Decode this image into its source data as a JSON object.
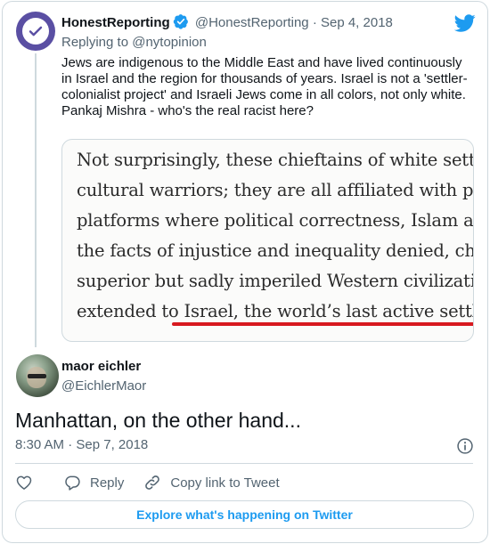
{
  "first_tweet": {
    "display_name": "HonestReporting",
    "handle": "@HonestReporting",
    "separator": "·",
    "date": "Sep 4, 2018",
    "replying_prefix": "Replying to",
    "replying_to": "@nytopinion",
    "text": "Jews are indigenous to the Middle East and have lived continuously in Israel and the region for thousands of years. Israel is not a 'settler-colonialist project' and Israeli Jews come in all colors, not only white. Pankaj Mishra - who's the real racist here?",
    "image_lines": [
      "Not surprisingly, these chieftains of white settle",
      "cultural warriors; they are all affiliated with pri",
      "platforms where political correctness, Islam and",
      "the facts of injustice and inequality denied, ches",
      "superior but sadly imperiled Western civilizatio",
      "extended to Israel, the world’s last active settler"
    ]
  },
  "second_tweet": {
    "display_name": "maor eichler",
    "handle": "@EichlerMaor",
    "text": "Manhattan, on the other hand...",
    "timestamp": "8:30 AM · Sep 7, 2018"
  },
  "actions": {
    "reply_label": "Reply",
    "copy_link_label": "Copy link to Tweet"
  },
  "explore_button": "Explore what's happening on Twitter",
  "icons": {
    "brand": "twitter-bird-icon",
    "verified": "verified-badge-icon",
    "info": "info-icon",
    "like": "heart-icon",
    "reply": "reply-bubble-icon",
    "copy_link": "link-icon"
  },
  "colors": {
    "accent": "#1d9bf0",
    "underline": "#d7191f"
  }
}
